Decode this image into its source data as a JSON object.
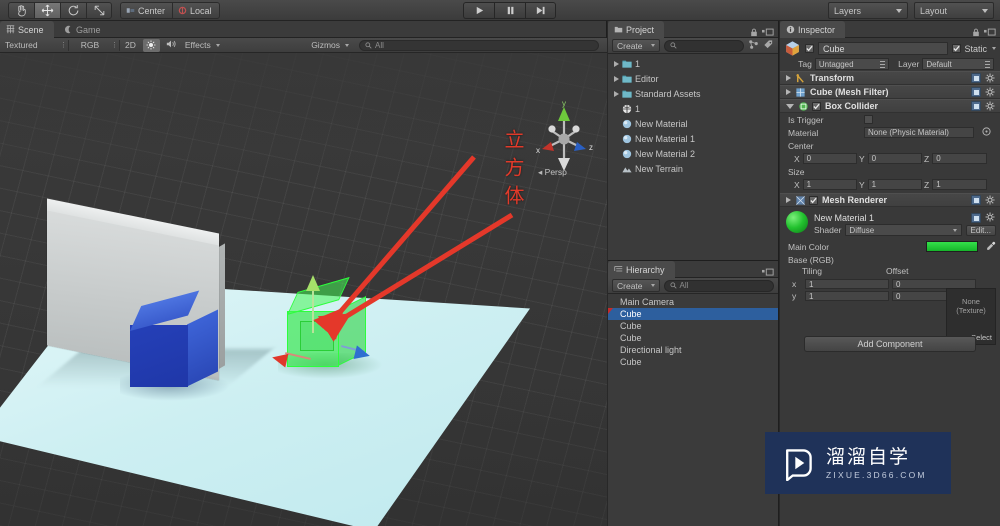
{
  "app": {
    "title": "Unity Editor"
  },
  "top_toolbar": {
    "transform_tools": [
      {
        "name": "hand-tool",
        "icon": "hand-icon",
        "active": false
      },
      {
        "name": "move-tool",
        "icon": "move-icon",
        "active": true
      },
      {
        "name": "rotate-tool",
        "icon": "rotate-icon",
        "active": false
      },
      {
        "name": "scale-tool",
        "icon": "scale-icon",
        "active": false
      }
    ],
    "pivot_label": "Center",
    "space_label": "Local",
    "play_buttons": [
      {
        "name": "play-button",
        "icon": "play-icon"
      },
      {
        "name": "pause-button",
        "icon": "pause-icon"
      },
      {
        "name": "step-button",
        "icon": "step-icon"
      }
    ],
    "layers_label": "Layers",
    "layout_label": "Layout"
  },
  "scene_panel": {
    "tabs": [
      {
        "label": "Scene",
        "icon": "scene-grid-icon",
        "selected": true
      },
      {
        "label": "Game",
        "icon": "game-moon-icon",
        "selected": false
      }
    ],
    "toolbar": {
      "draw_mode": "Textured",
      "render_mode": "RGB",
      "mode_2d": "2D",
      "lighting_icon": "sun-icon",
      "audio_icon": "speaker-icon",
      "effects_label": "Effects",
      "gizmos_label": "Gizmos",
      "search_placeholder": "All",
      "search_icon": "search-icon"
    },
    "gizmo": {
      "axis_x": "x",
      "axis_y": "y",
      "axis_z": "z",
      "projection_label": "Persp"
    },
    "annotation": {
      "text": "立方体",
      "color": "#e03a2a"
    },
    "objects": [
      {
        "name": "wall-plane",
        "label": "Cube",
        "color": "#cbd0d0"
      },
      {
        "name": "blue-cube",
        "label": "Cube",
        "color": "#2540b8"
      },
      {
        "name": "green-selected-cube",
        "label": "Cube",
        "color": "#28e63c"
      },
      {
        "name": "ground-plane",
        "label": "Cube",
        "color": "#cdeff2"
      }
    ]
  },
  "project_panel": {
    "tab_label": "Project",
    "tab_icon": "folder-icon",
    "create_label": "Create",
    "search_placeholder": "",
    "search_icon": "search-icon",
    "lock_icon": "lock-icon",
    "menu_icon": "panel-menu-icon",
    "items": [
      {
        "label": "1",
        "icon": "folder-icon",
        "expandable": true
      },
      {
        "label": "Editor",
        "icon": "folder-icon",
        "expandable": true
      },
      {
        "label": "Standard Assets",
        "icon": "folder-icon",
        "expandable": true
      },
      {
        "label": "1",
        "icon": "scene-asset-icon",
        "expandable": false
      },
      {
        "label": "New Material",
        "icon": "material-icon",
        "expandable": false
      },
      {
        "label": "New Material 1",
        "icon": "material-icon",
        "expandable": false
      },
      {
        "label": "New Material 2",
        "icon": "material-icon",
        "expandable": false
      },
      {
        "label": "New Terrain",
        "icon": "terrain-icon",
        "expandable": false
      }
    ]
  },
  "hierarchy_panel": {
    "tab_label": "Hierarchy",
    "tab_icon": "hierarchy-icon",
    "create_label": "Create",
    "search_placeholder": "All",
    "search_icon": "search-icon",
    "menu_icon": "panel-menu-icon",
    "items": [
      {
        "label": "Main Camera",
        "selected": false
      },
      {
        "label": "Cube",
        "selected": true
      },
      {
        "label": "Cube",
        "selected": false
      },
      {
        "label": "Cube",
        "selected": false
      },
      {
        "label": "Directional light",
        "selected": false
      },
      {
        "label": "Cube",
        "selected": false
      }
    ]
  },
  "inspector": {
    "tab_label": "Inspector",
    "tab_icon": "inspector-icon",
    "lock_icon": "lock-icon",
    "menu_icon": "panel-menu-icon",
    "object_name": "Cube",
    "object_enabled": true,
    "static_label": "Static",
    "static_checked": true,
    "tag_label": "Tag",
    "tag_value": "Untagged",
    "layer_label": "Layer",
    "layer_value": "Default",
    "components": [
      {
        "name": "transform",
        "title": "Transform",
        "icon": "transform-icon",
        "expanded": false,
        "enabled": null
      },
      {
        "name": "mesh-filter",
        "title": "Cube (Mesh Filter)",
        "icon": "mesh-filter-icon",
        "expanded": false,
        "enabled": null
      },
      {
        "name": "box-collider",
        "title": "Box Collider",
        "icon": "collider-icon",
        "expanded": true,
        "enabled": true
      }
    ],
    "box_collider": {
      "is_trigger_label": "Is Trigger",
      "is_trigger_checked": false,
      "material_label": "Material",
      "material_value": "None (Physic Material)",
      "center_label": "Center",
      "center": {
        "x_label": "X",
        "x": "0",
        "y_label": "Y",
        "y": "0",
        "z_label": "Z",
        "z": "0"
      },
      "size_label": "Size",
      "size": {
        "x_label": "X",
        "x": "1",
        "y_label": "Y",
        "y": "1",
        "z_label": "Z",
        "z": "1"
      }
    },
    "mesh_renderer": {
      "title": "Mesh Renderer",
      "icon": "mesh-renderer-icon",
      "enabled": true,
      "expanded": false
    },
    "material": {
      "name": "New Material 1",
      "shader_label": "Shader",
      "shader_value": "Diffuse",
      "edit_label": "Edit...",
      "main_color_label": "Main Color",
      "main_color_hex": "#22c82e",
      "base_rgb_label": "Base (RGB)",
      "texture_none_line1": "None",
      "texture_none_line2": "(Texture)",
      "select_label": "Select",
      "tiling_label": "Tiling",
      "offset_label": "Offset",
      "rows": [
        {
          "axis": "x",
          "tiling": "1",
          "offset": "0"
        },
        {
          "axis": "y",
          "tiling": "1",
          "offset": "0"
        }
      ]
    },
    "add_component_label": "Add Component"
  },
  "watermark": {
    "cn_text": "溜溜自学",
    "en_text": "ZIXUE.3D66.COM",
    "bg_color": "#1f3259",
    "icon": "play-logo-icon"
  }
}
